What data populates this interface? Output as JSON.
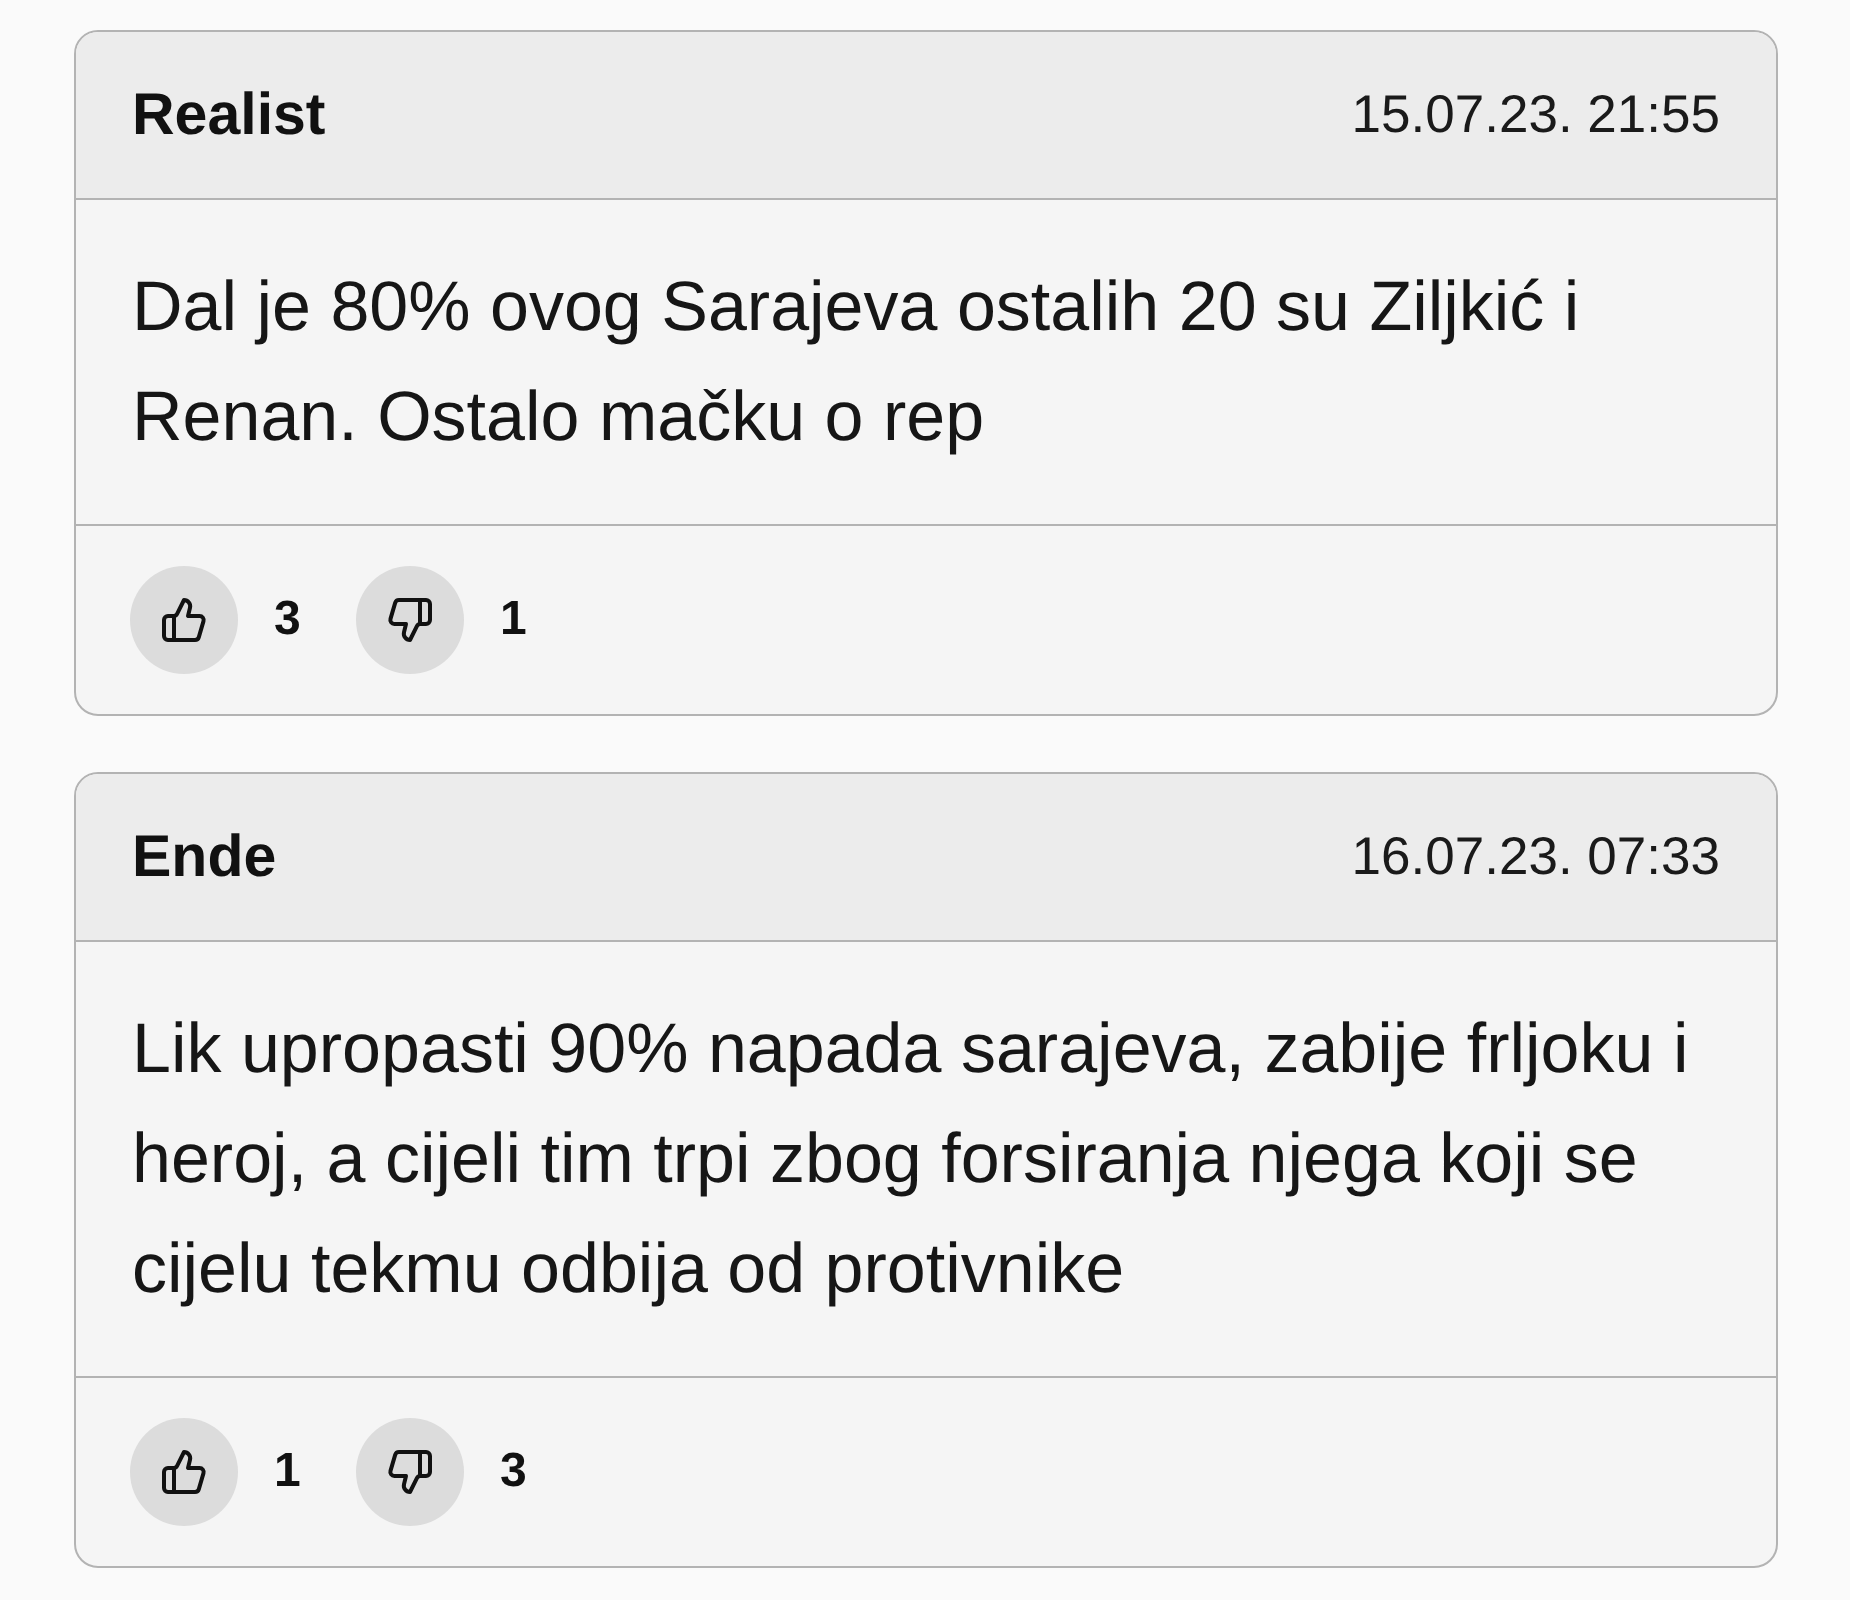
{
  "comments": [
    {
      "author": "Realist",
      "date": "15.07.23. 21:55",
      "text": "Dal je 80% ovog Sarajeva ostalih 20 su Ziljkić i Renan. Ostalo mačku o rep",
      "likes": "3",
      "dislikes": "1"
    },
    {
      "author": "Ende",
      "date": "16.07.23. 07:33",
      "text": "Lik upropasti 90% napada sarajeva, zabije frljoku i heroj, a cijeli tim trpi zbog forsiranja njega koji se cijelu tekmu odbija od protivnike",
      "likes": "1",
      "dislikes": "3"
    }
  ]
}
